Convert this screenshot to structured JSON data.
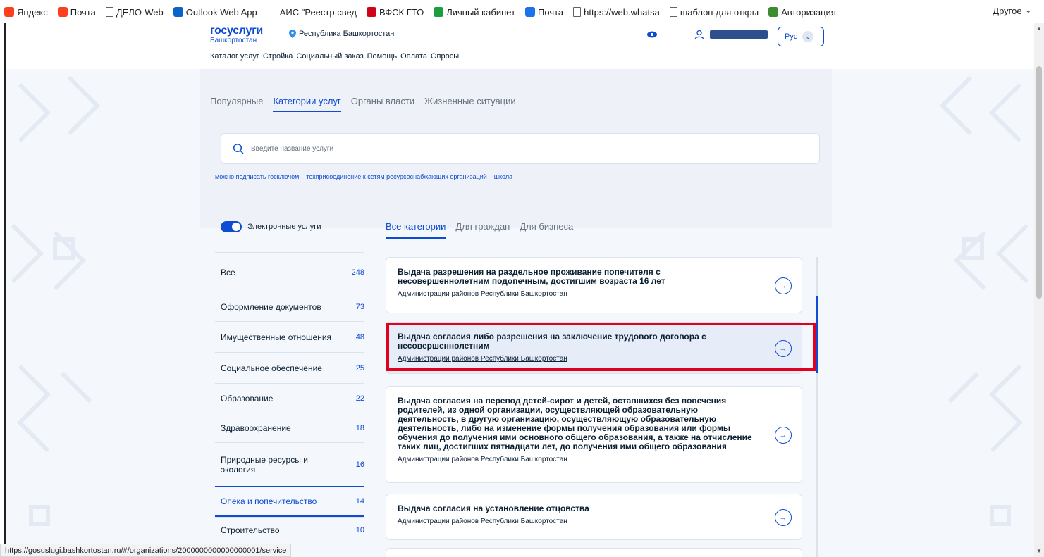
{
  "bookmarks": [
    {
      "label": "Яндекс",
      "icon": "yandex-icon",
      "color": "#fc3f1d"
    },
    {
      "label": "Почта",
      "icon": "yandex-mail-icon",
      "color": "#fc3f1d"
    },
    {
      "label": "ДЕЛО-Web",
      "icon": "page-icon",
      "color": "#5f6368"
    },
    {
      "label": "Outlook Web App",
      "icon": "outlook-icon",
      "color": "#0a64c8"
    },
    {
      "label": "АИС \"Реестр свед",
      "icon": "blank-icon",
      "color": "#ffffff"
    },
    {
      "label": "ВФСК ГТО",
      "icon": "gto-icon",
      "color": "#d0021b"
    },
    {
      "label": "Личный кабинет",
      "icon": "cabinet-icon",
      "color": "#1a9e3f"
    },
    {
      "label": "Почта",
      "icon": "mail-icon",
      "color": "#1a73e8"
    },
    {
      "label": "https://web.whatsa",
      "icon": "page-icon",
      "color": "#5f6368"
    },
    {
      "label": "шаблон для откры",
      "icon": "page-icon",
      "color": "#5f6368"
    },
    {
      "label": "Авторизация",
      "icon": "auth-icon",
      "color": "#3c8d2f"
    }
  ],
  "bookmarks_other": "Другое",
  "header": {
    "logo_top": "госуслуги",
    "logo_bottom": "Башкортостан",
    "region": "Республика Башкортостан",
    "lang": "Рус",
    "nav": [
      "Каталог услуг",
      "Стройка",
      "Социальный заказ",
      "Помощь",
      "Оплата",
      "Опросы"
    ]
  },
  "main_tabs": [
    "Популярные",
    "Категории услуг",
    "Органы власти",
    "Жизненные ситуации"
  ],
  "main_tab_active": 1,
  "search": {
    "placeholder": "Введите название услуги"
  },
  "chips": [
    "можно подписать госключом",
    "техприсоединение к сетям ресурсоснабжающих организаций",
    "школа"
  ],
  "toggle_label": "Электронные услуги",
  "category_tabs": [
    "Все категории",
    "Для граждан",
    "Для бизнеса"
  ],
  "category_tab_active": 0,
  "categories": [
    {
      "label": "Все",
      "count": "248"
    },
    {
      "label": "Оформление документов",
      "count": "73"
    },
    {
      "label": "Имущественные отношения",
      "count": "48"
    },
    {
      "label": "Социальное обеспечение",
      "count": "25"
    },
    {
      "label": "Образование",
      "count": "22"
    },
    {
      "label": "Здравоохранение",
      "count": "18"
    },
    {
      "label": "Природные ресурсы и экология",
      "count": "16"
    },
    {
      "label": "Опека и попечительство",
      "count": "14"
    },
    {
      "label": "Строительство",
      "count": "10"
    }
  ],
  "category_active": 7,
  "services": [
    {
      "title": "Выдача разрешения на раздельное проживание попечителя с несовершеннолетним подопечным, достигшим возраста 16 лет",
      "org": "Администрации районов Республики Башкортостан"
    },
    {
      "title": "Выдача согласия либо разрешения на заключение трудового договора с несовершеннолетним",
      "org": "Администрации районов Республики Башкортостан"
    },
    {
      "title": "Выдача согласия на перевод детей-сирот и детей, оставшихся без попечения родителей, из одной организации, осуществляющей образовательную деятельность, в другую организацию, осуществляющую образовательную деятельность, либо на изменение формы получения образования или формы обучения до получения ими основного общего образования, а также на отчисление таких лиц, достигших пятнадцати лет, до получения ими общего образования",
      "org": "Администрации районов Республики Башкортостан"
    },
    {
      "title": "Выдача согласия на установление отцовства",
      "org": "Администрации районов Республики Башкортостан"
    }
  ],
  "status_url": "https://gosuslugi.bashkortostan.ru/#/organizations/2000000000000000001/service",
  "colors": {
    "accent": "#0d4cd3",
    "highlight": "#e1001e",
    "logo_red": "#ee3f58"
  }
}
